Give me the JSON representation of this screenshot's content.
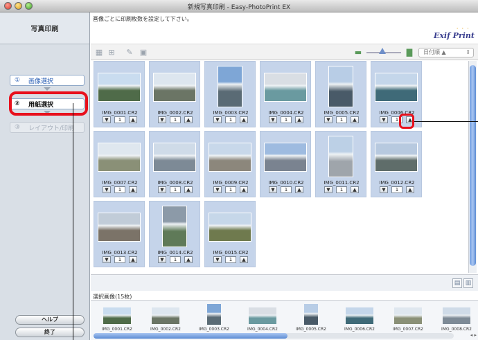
{
  "window": {
    "title": "新規写真印刷 - Easy-PhotoPrint EX"
  },
  "sidebar": {
    "header": "写真印刷",
    "steps": [
      {
        "num": "①",
        "label": "画像選択"
      },
      {
        "num": "②",
        "label": "用紙選択"
      },
      {
        "num": "③",
        "label": "レイアウト/印刷"
      }
    ],
    "help_label": "ヘルプ",
    "exit_label": "終了"
  },
  "main": {
    "instruction": "画像ごとに印刷枚数を設定して下さい。",
    "logo": "Exif Print",
    "sort_label": "日付順 ▲",
    "selected_label": "選択画像(15枚)"
  },
  "images": [
    {
      "name": "IMG_0001.CR2",
      "qty": "1",
      "sky": "#c9dcef",
      "land": "#4f6b49"
    },
    {
      "name": "IMG_0002.CR2",
      "qty": "1",
      "sky": "#dde6ef",
      "land": "#6b7565"
    },
    {
      "name": "IMG_0003.CR2",
      "qty": "1",
      "sky": "#7ea6d6",
      "land": "#5a6b75"
    },
    {
      "name": "IMG_0004.CR2",
      "qty": "1",
      "sky": "#d9dee4",
      "land": "#6a9aa0"
    },
    {
      "name": "IMG_0005.CR2",
      "qty": "1",
      "sky": "#b8cde6",
      "land": "#495a68"
    },
    {
      "name": "IMG_0006.CR2",
      "qty": "1",
      "sky": "#c4d6ea",
      "land": "#3f6a78"
    },
    {
      "name": "IMG_0007.CR2",
      "qty": "1",
      "sky": "#dfe7ef",
      "land": "#8a9077"
    },
    {
      "name": "IMG_0008.CR2",
      "qty": "1",
      "sky": "#cfdbe8",
      "land": "#7d8a96"
    },
    {
      "name": "IMG_0009.CR2",
      "qty": "1",
      "sky": "#c8d8ea",
      "land": "#8c877c"
    },
    {
      "name": "IMG_0010.CR2",
      "qty": "1",
      "sky": "#9ebbe0",
      "land": "#7a8390"
    },
    {
      "name": "IMG_0011.CR2",
      "qty": "1",
      "sky": "#bcd0e6",
      "land": "#9fa5ab"
    },
    {
      "name": "IMG_0012.CR2",
      "qty": "1",
      "sky": "#b7c9df",
      "land": "#5f6d6a"
    },
    {
      "name": "IMG_0013.CR2",
      "qty": "1",
      "sky": "#c1ccd8",
      "land": "#7b7368"
    },
    {
      "name": "IMG_0014.CR2",
      "qty": "1",
      "sky": "#8c9aa8",
      "land": "#5f7a58"
    },
    {
      "name": "IMG_0015.CR2",
      "qty": "1",
      "sky": "#c6d7e9",
      "land": "#6f7a4e"
    }
  ],
  "strip": [
    {
      "name": "IMG_0001.CR2"
    },
    {
      "name": "IMG_0002.CR2"
    },
    {
      "name": "IMG_0003.CR2"
    },
    {
      "name": "IMG_0004.CR2"
    },
    {
      "name": "IMG_0005.CR2"
    },
    {
      "name": "IMG_0006.CR2"
    },
    {
      "name": "IMG_0007.CR2"
    },
    {
      "name": "IMG_0008.CR2"
    }
  ],
  "icons": {
    "toolbar_left": [
      "grid-small-icon",
      "grid-large-icon",
      "correction-brush-icon",
      "photo-frame-icon"
    ],
    "zoom_small": "small-photo-icon",
    "zoom_large": "large-photo-icon"
  },
  "colors": {
    "highlight": "#e8101c",
    "selection": "#c5d4ea",
    "accent": "#5c8bd3"
  }
}
